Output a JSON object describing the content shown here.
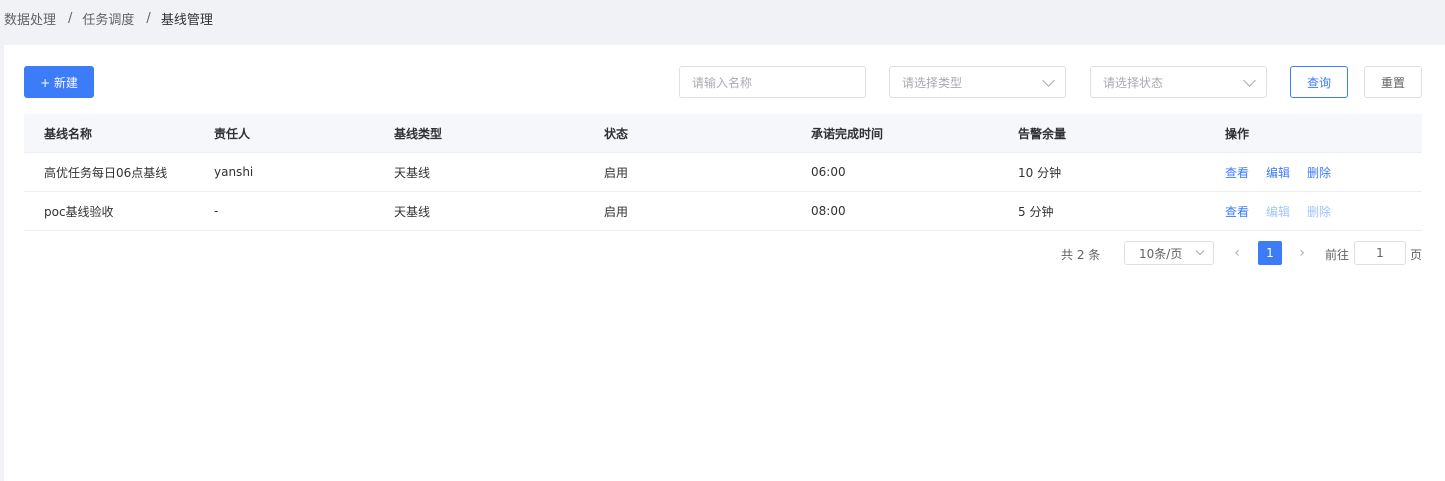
{
  "breadcrumb": [
    "数据处理",
    "任务调度",
    "基线管理"
  ],
  "toolbar": {
    "new_label": "+ 新建",
    "name_placeholder": "请输入名称",
    "type_placeholder": "请选择类型",
    "status_placeholder": "请选择状态",
    "query_label": "查询",
    "reset_label": "重置"
  },
  "table": {
    "headers": [
      "基线名称",
      "责任人",
      "基线类型",
      "状态",
      "承诺完成时间",
      "告警余量",
      "操作"
    ],
    "rows": [
      {
        "name": "高优任务每日06点基线",
        "owner": "yanshi",
        "type": "天基线",
        "status": "启用",
        "time": "06:00",
        "margin": "10 分钟",
        "ops": [
          "查看",
          "编辑",
          "删除"
        ]
      },
      {
        "name": "poc基线验收",
        "owner": "-",
        "type": "天基线",
        "status": "启用",
        "time": "08:00",
        "margin": "5 分钟",
        "ops": [
          "查看",
          "编辑",
          "删除"
        ]
      }
    ]
  },
  "pagination": {
    "total": "共 2 条",
    "page_size": "10条/页",
    "current_page": "1",
    "goto_label": "前往",
    "goto_value": "1",
    "goto_unit": "页"
  },
  "colors": {
    "primary": "#3d7cf9",
    "disabled_link": "#a0c4fb"
  }
}
